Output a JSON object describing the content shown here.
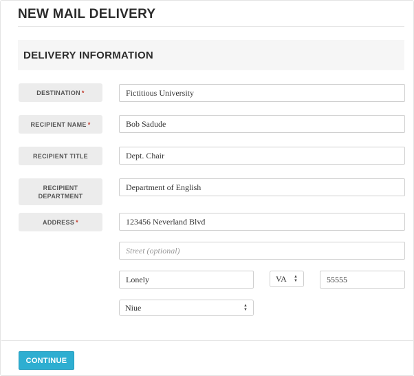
{
  "page": {
    "title": "NEW MAIL DELIVERY"
  },
  "section": {
    "title": "DELIVERY INFORMATION"
  },
  "form": {
    "destination": {
      "label": "DESTINATION",
      "required_mark": "*",
      "value": "Fictitious University"
    },
    "recipient_name": {
      "label": "RECIPIENT NAME",
      "required_mark": "*",
      "value": "Bob Sadude"
    },
    "recipient_title": {
      "label": "RECIPIENT TITLE",
      "value": "Dept. Chair"
    },
    "recipient_department": {
      "label_line1": "RECIPIENT",
      "label_line2": "DEPARTMENT",
      "value": "Department of English"
    },
    "address": {
      "label": "ADDRESS",
      "required_mark": "*",
      "street1": "123456 Neverland Blvd",
      "street2_placeholder": "Street (optional)",
      "city": "Lonely",
      "state": "VA",
      "zip": "55555",
      "country": "Niue"
    }
  },
  "actions": {
    "continue_label": "CONTINUE"
  },
  "colors": {
    "accent": "#2eaed1",
    "required": "#c0392b",
    "label_bg": "#ececec"
  }
}
